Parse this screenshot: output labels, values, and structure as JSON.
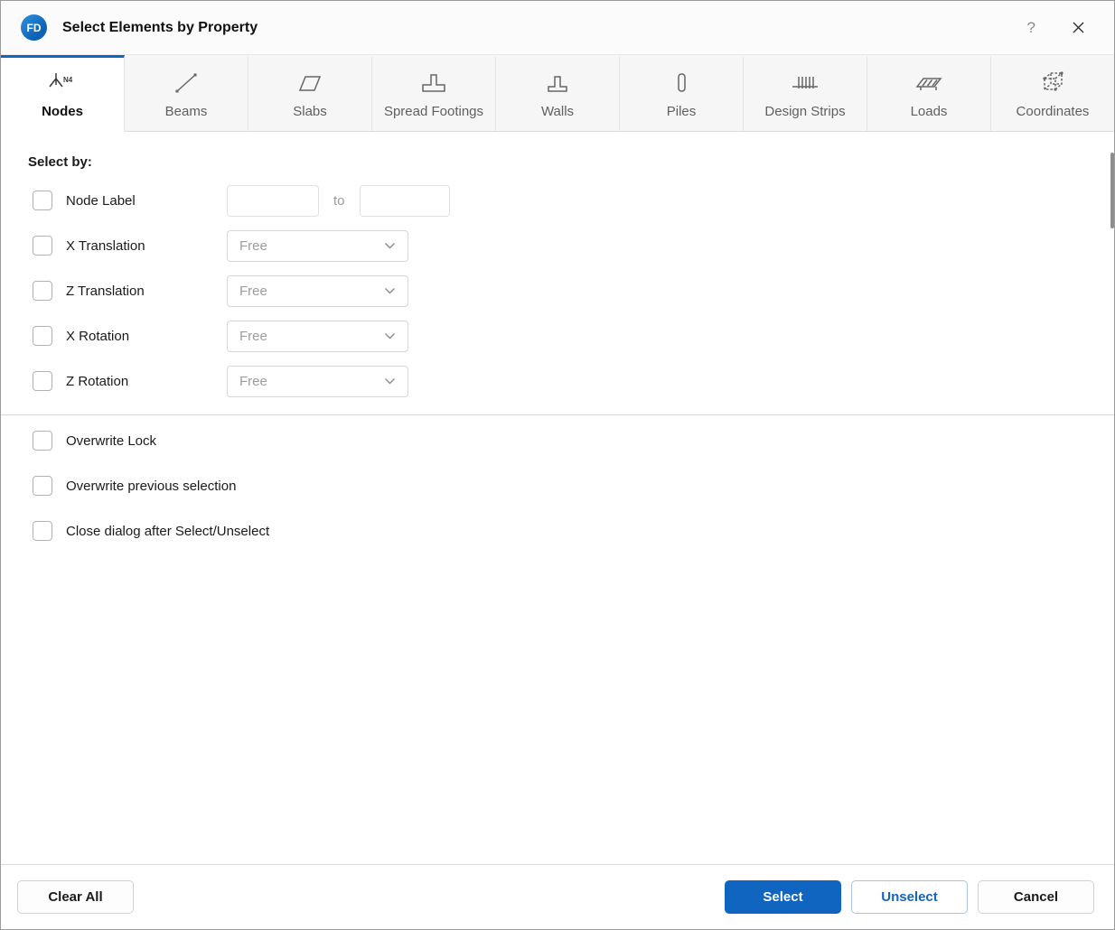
{
  "titlebar": {
    "logo": "FD",
    "title": "Select Elements by Property",
    "help_label": "?"
  },
  "tabs": [
    {
      "label": "Nodes",
      "icon": "nodes-icon",
      "icon_text": "N4",
      "active": true
    },
    {
      "label": "Beams",
      "icon": "beam-icon",
      "active": false
    },
    {
      "label": "Slabs",
      "icon": "slab-icon",
      "active": false
    },
    {
      "label": "Spread Footings",
      "icon": "spread-footing-icon",
      "active": false
    },
    {
      "label": "Walls",
      "icon": "wall-icon",
      "active": false
    },
    {
      "label": "Piles",
      "icon": "pile-icon",
      "active": false
    },
    {
      "label": "Design Strips",
      "icon": "design-strips-icon",
      "active": false
    },
    {
      "label": "Loads",
      "icon": "loads-icon",
      "active": false
    },
    {
      "label": "Coordinates",
      "icon": "coordinates-icon",
      "active": false
    }
  ],
  "content": {
    "select_by_label": "Select by:",
    "node_label": {
      "label": "Node Label",
      "from_value": "",
      "to_label": "to",
      "to_value": "",
      "checked": false
    },
    "filters": [
      {
        "label": "X Translation",
        "value": "Free",
        "checked": false
      },
      {
        "label": "Z Translation",
        "value": "Free",
        "checked": false
      },
      {
        "label": "X Rotation",
        "value": "Free",
        "checked": false
      },
      {
        "label": "Z Rotation",
        "value": "Free",
        "checked": false
      }
    ],
    "options": [
      {
        "label": "Overwrite Lock",
        "checked": false
      },
      {
        "label": "Overwrite previous selection",
        "checked": false
      },
      {
        "label": "Close dialog after Select/Unselect",
        "checked": false
      }
    ]
  },
  "footer": {
    "clear_all_label": "Clear All",
    "select_label": "Select",
    "unselect_label": "Unselect",
    "cancel_label": "Cancel"
  },
  "colors": {
    "accent": "#1065c0"
  }
}
